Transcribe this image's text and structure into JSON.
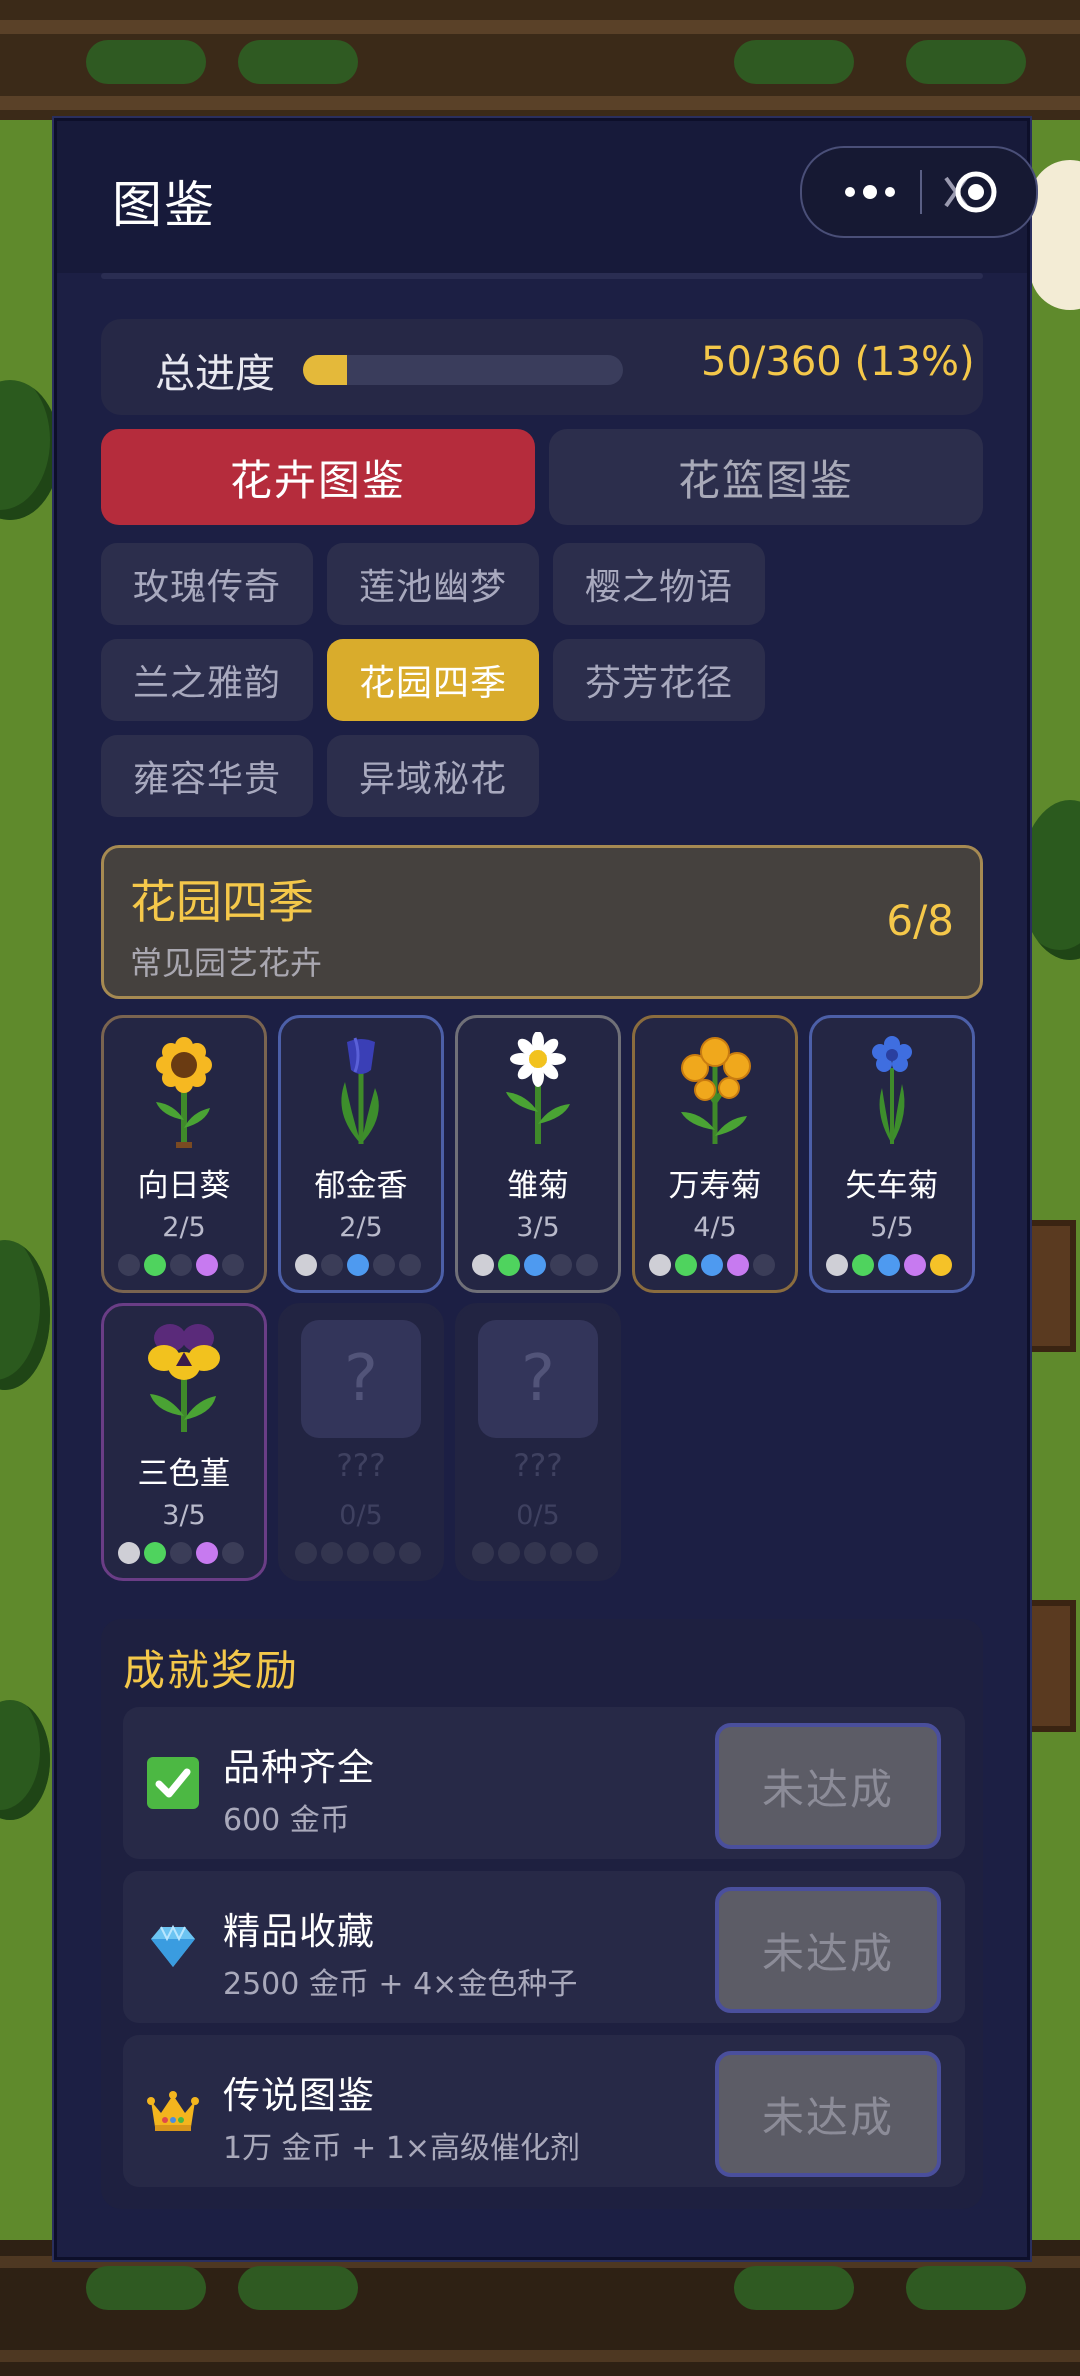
{
  "header": {
    "title": "图鉴",
    "menu_icon": "more-dots-icon",
    "close_icon": "close-target-icon"
  },
  "progress": {
    "label": "总进度",
    "value_text": "50/360 (13%)",
    "fraction": 0.139
  },
  "main_tabs": [
    {
      "label": "花卉图鉴",
      "active": true
    },
    {
      "label": "花篮图鉴",
      "active": false
    }
  ],
  "series_tabs": [
    {
      "label": "玫瑰传奇",
      "active": false
    },
    {
      "label": "莲池幽梦",
      "active": false
    },
    {
      "label": "樱之物语",
      "active": false
    },
    {
      "label": "兰之雅韵",
      "active": false
    },
    {
      "label": "花园四季",
      "active": true
    },
    {
      "label": "芬芳花径",
      "active": false
    },
    {
      "label": "雍容华贵",
      "active": false
    },
    {
      "label": "异域秘花",
      "active": false
    }
  ],
  "series": {
    "name": "花园四季",
    "description": "常见园艺花卉",
    "count": "6/8"
  },
  "flowers": [
    {
      "name": "向日葵",
      "count": "2/5",
      "icon": "sunflower-icon",
      "locked": false,
      "dots": [
        "#3b3d58",
        "#4fd35e",
        "#3b3d58",
        "#c77af0",
        "#3b3d58"
      ]
    },
    {
      "name": "郁金香",
      "count": "2/5",
      "icon": "tulip-icon",
      "locked": false,
      "dots": [
        "#cfcfd6",
        "#3b3d58",
        "#4e9af0",
        "#3b3d58",
        "#3b3d58"
      ]
    },
    {
      "name": "雏菊",
      "count": "3/5",
      "icon": "daisy-icon",
      "locked": false,
      "dots": [
        "#cfcfd6",
        "#4fd35e",
        "#4e9af0",
        "#3b3d58",
        "#3b3d58"
      ]
    },
    {
      "name": "万寿菊",
      "count": "4/5",
      "icon": "marigold-icon",
      "locked": false,
      "dots": [
        "#cfcfd6",
        "#4fd35e",
        "#4e9af0",
        "#c77af0",
        "#3b3d58"
      ]
    },
    {
      "name": "矢车菊",
      "count": "5/5",
      "icon": "cornflower-icon",
      "locked": false,
      "dots": [
        "#cfcfd6",
        "#4fd35e",
        "#4e9af0",
        "#c77af0",
        "#f5c228"
      ]
    },
    {
      "name": "三色堇",
      "count": "3/5",
      "icon": "pansy-icon",
      "locked": false,
      "dots": [
        "#cfcfd6",
        "#4fd35e",
        "#3b3d58",
        "#c77af0",
        "#3b3d58"
      ]
    },
    {
      "name": "???",
      "count": "0/5",
      "icon": "question-icon",
      "locked": true,
      "placeholder": "?",
      "dots": [
        "#33354f",
        "#33354f",
        "#33354f",
        "#33354f",
        "#33354f"
      ]
    },
    {
      "name": "???",
      "count": "0/5",
      "icon": "question-icon",
      "locked": true,
      "placeholder": "?",
      "dots": [
        "#33354f",
        "#33354f",
        "#33354f",
        "#33354f",
        "#33354f"
      ]
    }
  ],
  "achievements": {
    "title": "成就奖励",
    "items": [
      {
        "name": "品种齐全",
        "reward": "600 金币",
        "icon": "check-icon",
        "button": "未达成"
      },
      {
        "name": "精品收藏",
        "reward": "2500 金币 + 4×金色种子",
        "icon": "diamond-icon",
        "button": "未达成"
      },
      {
        "name": "传说图鉴",
        "reward": "1万 金币 + 1×高级催化剂",
        "icon": "crown-icon",
        "button": "未达成"
      }
    ]
  }
}
